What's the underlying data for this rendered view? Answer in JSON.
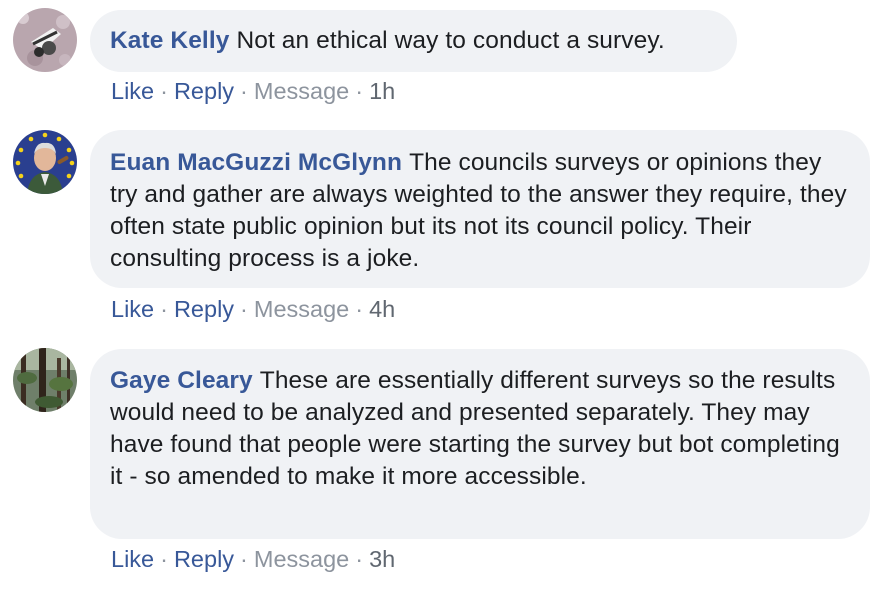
{
  "comments": [
    {
      "author": "Kate Kelly",
      "text": "Not an ethical way to conduct a survey.",
      "actions": {
        "like": "Like",
        "reply": "Reply",
        "message": "Message"
      },
      "time": "1h",
      "avatar_icon": "ski-photo-avatar"
    },
    {
      "author": "Euan MacGuzzi McGlynn",
      "text": "The councils surveys or opinions they try and gather are always weighted to the answer they require, they often state public opinion but its not its council policy. Their consulting process is a joke.",
      "actions": {
        "like": "Like",
        "reply": "Reply",
        "message": "Message"
      },
      "time": "4h",
      "avatar_icon": "eu-flag-portrait-avatar"
    },
    {
      "author": "Gaye Cleary",
      "text": "These are essentially different surveys so the results would need to be analyzed and presented separately. They may have found that people were starting the survey but bot completing it - so amended to make it more accessible.",
      "actions": {
        "like": "Like",
        "reply": "Reply",
        "message": "Message"
      },
      "time": "3h",
      "avatar_icon": "forest-photo-avatar"
    }
  ],
  "colors": {
    "author_link": "#385898",
    "bubble_bg": "#f0f2f5",
    "text": "#1c1e21",
    "muted": "#8d949e",
    "time": "#606770"
  }
}
